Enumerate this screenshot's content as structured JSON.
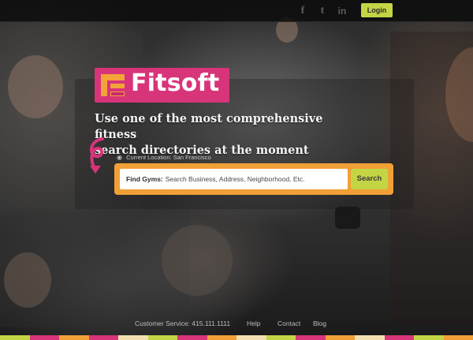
{
  "header": {
    "social": [
      {
        "name": "facebook",
        "glyph": "f"
      },
      {
        "name": "twitter",
        "glyph": "t"
      },
      {
        "name": "linkedin",
        "glyph": "in"
      }
    ],
    "login_label": "Login"
  },
  "brand": {
    "name": "Fitsoft",
    "color": "#d8347a",
    "mark_color": "#f3a33a"
  },
  "hero": {
    "headline_line1": "Use one of the most comprehensive fitness",
    "headline_line2": "search directories at the moment"
  },
  "location": {
    "icon": "map-pin-icon",
    "text": "Current Location: San Francisco"
  },
  "search": {
    "label": "Find Gyms:",
    "placeholder": "Search Business, Address, Neighborhood, Etc.",
    "button_label": "Search",
    "frame_color": "#f0a037",
    "button_color": "#c3d544"
  },
  "footer": {
    "customer_service": "Customer Service: 415.111.1111",
    "help": "Help",
    "contact": "Contact",
    "blog": "Blog"
  },
  "strip_colors": [
    "#c3d544",
    "#d8347a",
    "#f0a037",
    "#d8347a",
    "#f3e0b0",
    "#c3d544",
    "#d8347a",
    "#f0a037",
    "#f3e0b0",
    "#c3d544",
    "#d8347a",
    "#f0a037",
    "#f3e0b0",
    "#d8347a",
    "#c3d544",
    "#f0a037"
  ]
}
